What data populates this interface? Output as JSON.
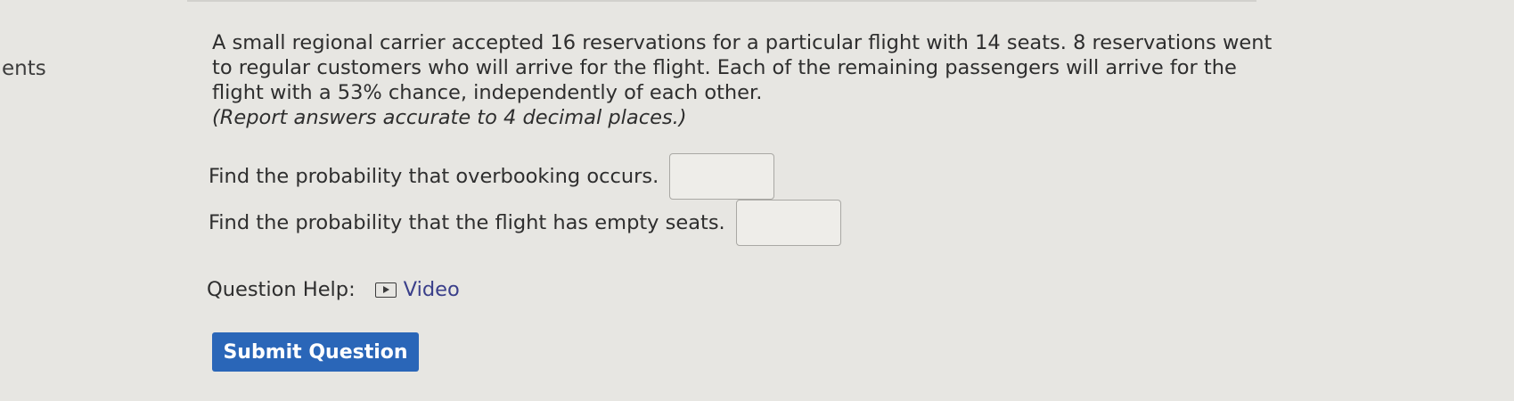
{
  "sidebar": {
    "partial_label": "ents"
  },
  "question": {
    "paragraph_lines": [
      "A small regional carrier accepted 16 reservations for a particular flight with 14 seats. 8 reservations went",
      "to regular customers who will arrive for the flight. Each of the remaining passengers will arrive for the",
      "flight with a 53% chance, independently of each other."
    ],
    "note": "(Report answers accurate to 4 decimal places.)",
    "parts": [
      {
        "prompt": "Find the probability that overbooking occurs.",
        "answer_value": ""
      },
      {
        "prompt": "Find the probability that the flight has empty seats.",
        "answer_value": ""
      }
    ]
  },
  "help": {
    "label": "Question Help:",
    "video_label": "Video",
    "video_icon": "play-icon"
  },
  "submit": {
    "label": "Submit Question",
    "color": "#2a66b8"
  }
}
